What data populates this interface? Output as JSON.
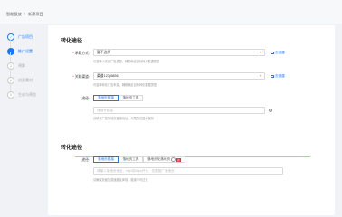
{
  "breadcrumb": {
    "home": "智能投放",
    "separator": "/",
    "current": "新建项目"
  },
  "steps": [
    {
      "label": "广告项目",
      "marker": "✓",
      "state": "done"
    },
    {
      "label": "推广设置",
      "marker": "",
      "state": "active"
    },
    {
      "label": "预算",
      "marker": "3",
      "state": "todo"
    },
    {
      "label": "创意素材",
      "marker": "4",
      "state": "todo"
    },
    {
      "label": "生成与预览",
      "marker": "5",
      "state": "todo"
    }
  ],
  "section1": {
    "title": "转化途径",
    "row1": {
      "label": "承载方式",
      "value": "暂不选择",
      "hint": "可选择小来自广告类型，辅助确定目标转化数据类型",
      "link": "去创建"
    },
    "row2": {
      "label": "关联渠道",
      "value": "渠道123(6856)",
      "hint": "可选择转化广告来源，辅助确定目标转化数据类型",
      "link": "去创建"
    },
    "row3": {
      "label": "途径",
      "tabs": [
        "落地页链接",
        "落地页工具"
      ],
      "input_placeholder": "请填写链接",
      "hint": "请填写广告落地页链接地址，与预览位显示保持"
    }
  },
  "section2": {
    "title": "转化途径",
    "row": {
      "label": "途径",
      "tabs": [
        "落地页链接",
        "落地页工具",
        "落地页化落地页"
      ],
      "badge": "新",
      "input_placeholder": "请输入落地页地址，http或https开头，仅限推广落地页",
      "hint": "请确保页面加载速度及体验，链接不可过长"
    }
  },
  "colors": {
    "accent": "#1677ff",
    "danger": "#f5222d",
    "page_bg": "#f0f2f5"
  },
  "icons": {
    "link": "link-icon",
    "info": "info-icon",
    "caret": "chevron-down-icon"
  }
}
